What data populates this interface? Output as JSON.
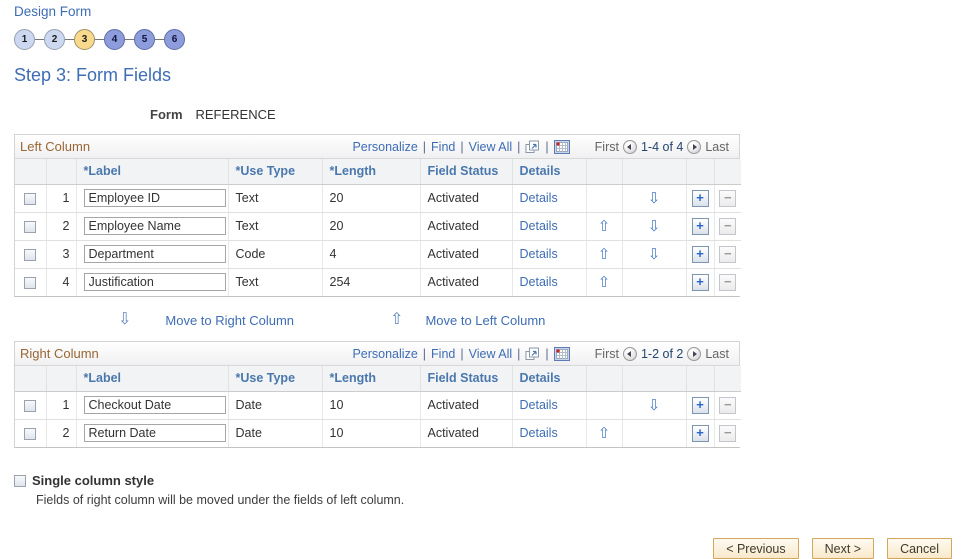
{
  "page": {
    "breadcrumb": "Design Form",
    "title": "Step 3: Form Fields",
    "form_label": "Form",
    "form_value": "REFERENCE"
  },
  "steps": [
    {
      "num": "1",
      "state": "past"
    },
    {
      "num": "2",
      "state": "past"
    },
    {
      "num": "3",
      "state": "current"
    },
    {
      "num": "4",
      "state": "future"
    },
    {
      "num": "5",
      "state": "future"
    },
    {
      "num": "6",
      "state": "future"
    }
  ],
  "toolbar": {
    "personalize": "Personalize",
    "find": "Find",
    "view_all": "View All",
    "first": "First",
    "last": "Last",
    "popup_icon": "popup-icon",
    "download_icon": "download-grid-icon"
  },
  "grid_headers": {
    "label": "*Label",
    "use_type": "*Use Type",
    "length": "*Length",
    "status": "Field Status",
    "details": "Details"
  },
  "left_grid": {
    "title": "Left Column",
    "pagination": "1-4 of 4",
    "rows": [
      {
        "num": "1",
        "label": "Employee ID",
        "use_type": "Text",
        "length": "20",
        "status": "Activated",
        "details": "Details",
        "up": false,
        "down": true
      },
      {
        "num": "2",
        "label": "Employee Name",
        "use_type": "Text",
        "length": "20",
        "status": "Activated",
        "details": "Details",
        "up": true,
        "down": true
      },
      {
        "num": "3",
        "label": "Department",
        "use_type": "Code",
        "length": "4",
        "status": "Activated",
        "details": "Details",
        "up": true,
        "down": true
      },
      {
        "num": "4",
        "label": "Justification",
        "use_type": "Text",
        "length": "254",
        "status": "Activated",
        "details": "Details",
        "up": true,
        "down": false
      }
    ]
  },
  "right_grid": {
    "title": "Right Column",
    "pagination": "1-2 of 2",
    "rows": [
      {
        "num": "1",
        "label": "Checkout Date",
        "use_type": "Date",
        "length": "10",
        "status": "Activated",
        "details": "Details",
        "up": false,
        "down": true
      },
      {
        "num": "2",
        "label": "Return Date",
        "use_type": "Date",
        "length": "10",
        "status": "Activated",
        "details": "Details",
        "up": true,
        "down": false
      }
    ]
  },
  "move_links": {
    "to_right": "Move to Right Column",
    "to_left": "Move to Left Column"
  },
  "single_column": {
    "label": "Single column style",
    "note": "Fields of right column will be moved under the fields of left column.",
    "checked": false
  },
  "footer": {
    "previous": "< Previous",
    "next": "Next >",
    "cancel": "Cancel"
  },
  "colors": {
    "link_blue": "#3e6db5",
    "grid_title_orange": "#996633",
    "header_text_blue": "#4a78ad",
    "step_past": "#ccd8ef",
    "step_current": "#f9d98c",
    "step_future": "#8d9cdb",
    "button_face": "#f9e9cb",
    "button_border": "#d3a75c"
  }
}
